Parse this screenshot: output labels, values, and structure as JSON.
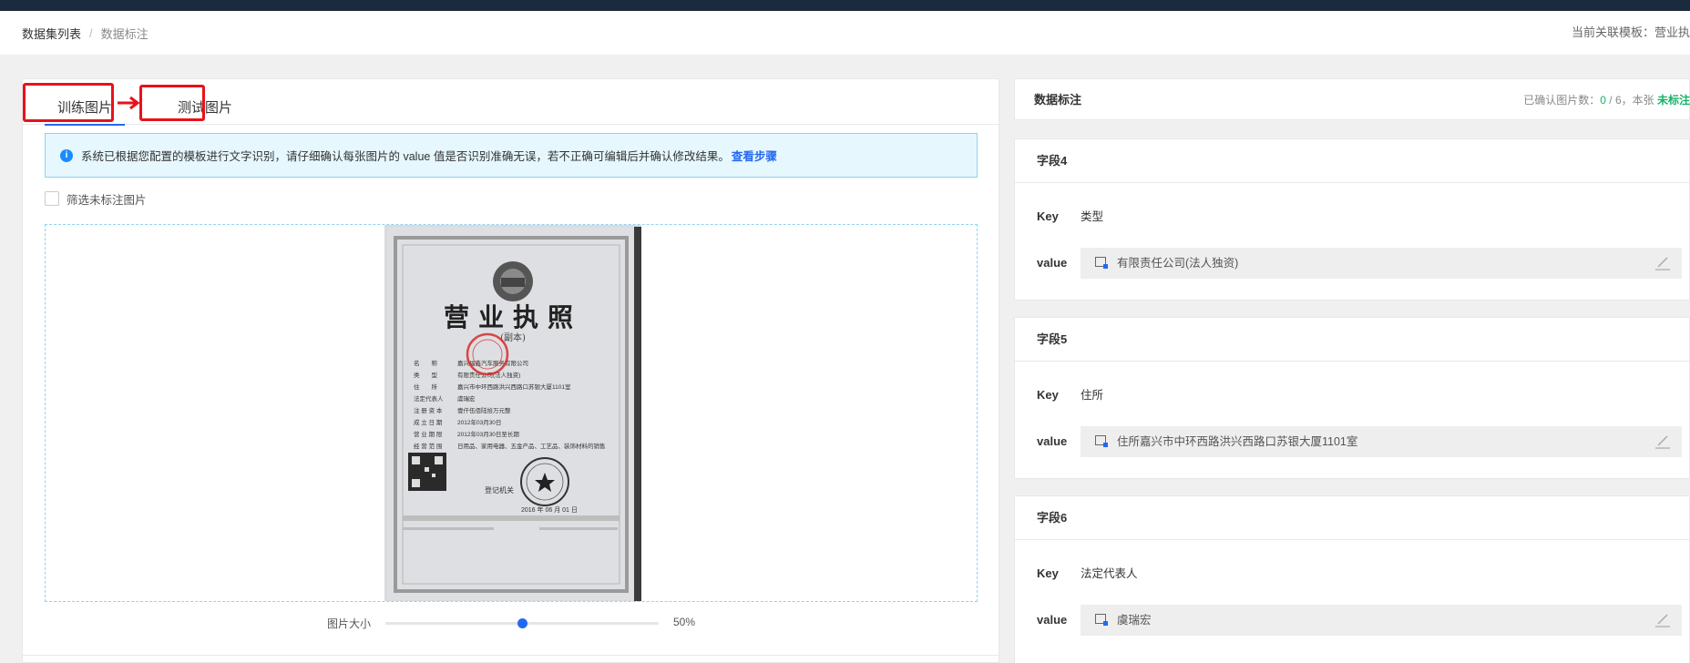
{
  "breadcrumb": {
    "items": [
      "数据集列表",
      "数据标注"
    ],
    "separator": "/"
  },
  "template_info": "当前关联模板：营业执",
  "tabs": [
    {
      "label": "训练图片",
      "active": true
    },
    {
      "label": "测试图片",
      "active": false
    }
  ],
  "alert": {
    "text": "系统已根据您配置的模板进行文字识别，请仔细确认每张图片的 value 值是否识别准确无误，若不正确可编辑后并确认修改结果。",
    "link": "查看步骤"
  },
  "filter": {
    "label": "筛选未标注图片",
    "checked": false
  },
  "image_size": {
    "label": "图片大小",
    "value_text": "50%",
    "value": 0.5
  },
  "panel": {
    "title": "数据标注",
    "status": {
      "prefix": "已确认图片数：",
      "confirmed": "0",
      "sep": " / ",
      "total": "6",
      "mid": "，本张 ",
      "tag": "未标注"
    }
  },
  "fields": [
    {
      "name": "字段4",
      "key_label": "Key",
      "key": "类型",
      "value_label": "value",
      "value": "有限责任公司(法人独资)"
    },
    {
      "name": "字段5",
      "key_label": "Key",
      "key": "住所",
      "value_label": "value",
      "value": "住所嘉兴市中环西路洪兴西路口苏银大厦1101室"
    },
    {
      "name": "字段6",
      "key_label": "Key",
      "key": "法定代表人",
      "value_label": "value",
      "value": "虞瑞宏"
    }
  ],
  "license_image": {
    "title": "营业执照",
    "subtitle": "(副本)",
    "issuer": "登记机关",
    "year": "2016",
    "month": "06",
    "day": "01",
    "rows": [
      {
        "label": "名　　称",
        "value": "嘉兴福鑫汽车服务有限公司"
      },
      {
        "label": "类　　型",
        "value": "有限责任公司(法人独资)"
      },
      {
        "label": "住　　所",
        "value": "嘉兴市中环西路洪兴西路口苏银大厦1101室"
      },
      {
        "label": "法定代表人",
        "value": "虞瑞宏"
      },
      {
        "label": "注 册 资 本",
        "value": "壹仟伍佰陆拾万元整"
      },
      {
        "label": "成 立 日 期",
        "value": "2012年03月30日"
      },
      {
        "label": "营 业 期 限",
        "value": "2012年03月30日至长期"
      },
      {
        "label": "经 营 范 围",
        "value": "日用品、家用电器、五金产品、工艺品、装饰材料的销售"
      }
    ]
  },
  "colors": {
    "accent": "#2468f2",
    "success": "#17b26a",
    "highlight_box": "#e8121a",
    "seal": "#d62b2b"
  },
  "icons": [
    "info-icon",
    "arrow-right-icon",
    "value-select-icon",
    "edit-pencil-icon",
    "national-emblem-icon",
    "qr-code-icon",
    "seal-stamp-icon"
  ]
}
